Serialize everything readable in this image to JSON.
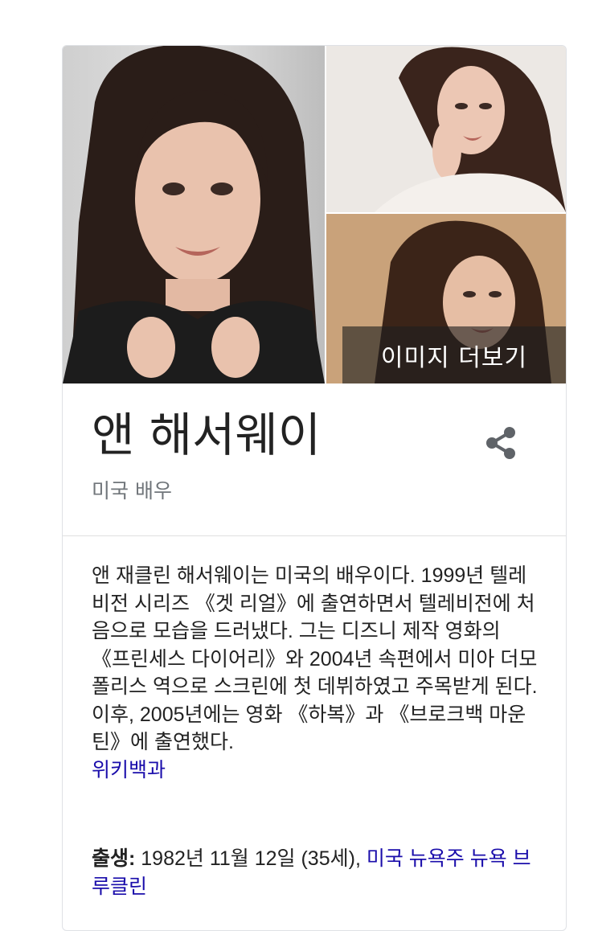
{
  "knowledge_panel": {
    "more_images_label": "이미지 더보기",
    "title": "앤 해서웨이",
    "subtitle": "미국 배우",
    "share_icon": "share-icon",
    "description": "앤 재클린 해서웨이는 미국의 배우이다. 1999년 텔레비전 시리즈 《겟 리얼》에 출연하면서 텔레비전에 처음으로 모습을 드러냈다. 그는 디즈니 제작 영화의 《프린세스 다이어리》와 2004년 속편에서 미아 더모폴리스 역으로 스크린에 첫 데뷔하였고 주목받게 된다. 이후, 2005년에는 영화 《하복》과 《브로크백 마운틴》에 출연했다.",
    "source_link": "위키백과",
    "facts": {
      "born_label": "출생:",
      "born_value": " 1982년 11월 12일 (35세), ",
      "born_place_link": "미국 뉴욕주 뉴욕 브루클린"
    }
  },
  "colors": {
    "link": "#1a0dab",
    "title": "#222222",
    "subtitle": "#70757a",
    "border": "#dfe1e5"
  }
}
